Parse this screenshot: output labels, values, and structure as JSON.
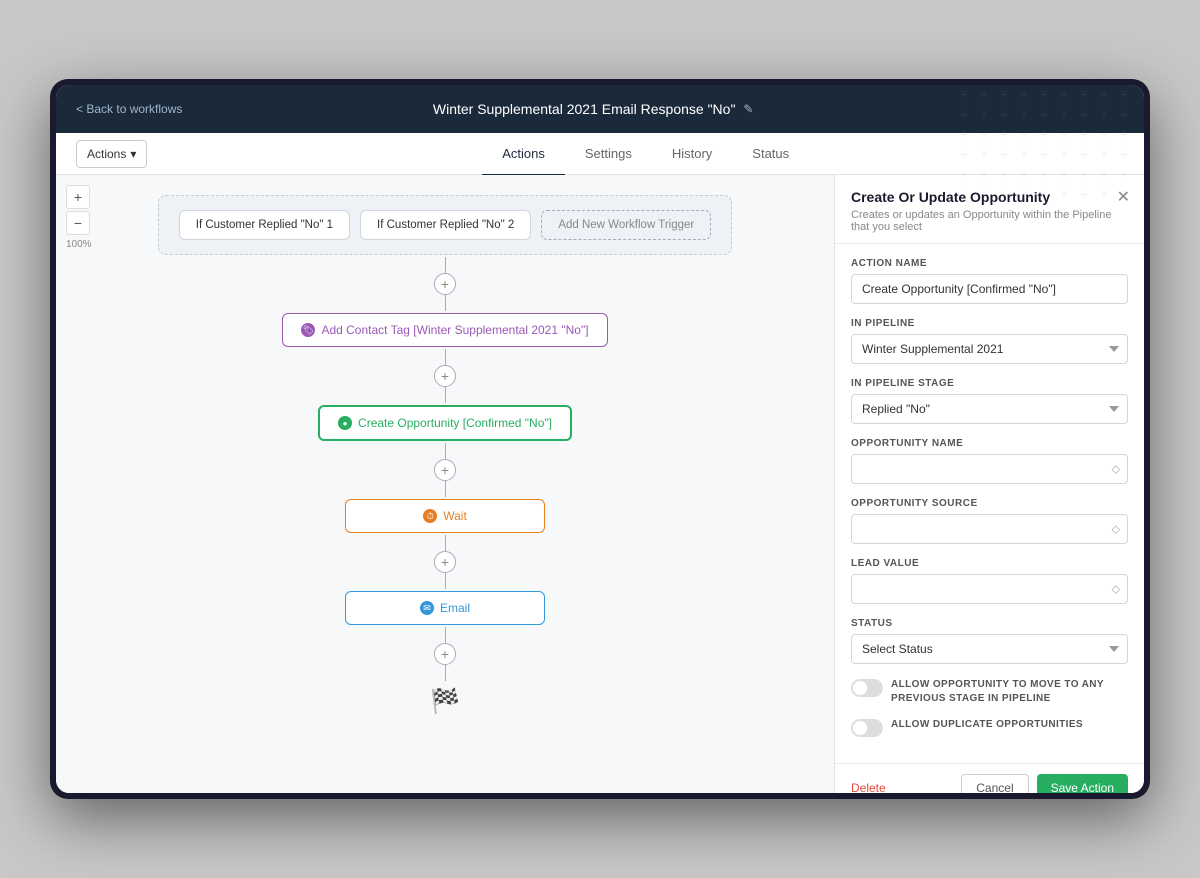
{
  "header": {
    "back_label": "< Back to workflows",
    "title": "Winter Supplemental 2021 Email Response \"No\"",
    "edit_icon": "✎"
  },
  "tabs_bar": {
    "actions_btn": "Actions",
    "tabs": [
      {
        "id": "actions",
        "label": "Actions",
        "active": true
      },
      {
        "id": "settings",
        "label": "Settings",
        "active": false
      },
      {
        "id": "history",
        "label": "History",
        "active": false
      },
      {
        "id": "status",
        "label": "Status",
        "active": false
      }
    ]
  },
  "canvas": {
    "zoom_plus": "+",
    "zoom_minus": "−",
    "zoom_level": "100%",
    "triggers": [
      {
        "label": "If Customer Replied \"No\" 1"
      },
      {
        "label": "If Customer Replied \"No\" 2"
      }
    ],
    "add_trigger_label": "Add New Workflow Trigger",
    "actions": [
      {
        "id": "tag",
        "type": "tag",
        "icon_color": "purple",
        "icon_char": "🏷",
        "label": "Add Contact Tag [Winter Supplemental 2021 \"No\"]"
      },
      {
        "id": "opportunity",
        "type": "opportunity",
        "icon_color": "green",
        "icon_char": "●",
        "label": "Create Opportunity [Confirmed \"No\"]"
      },
      {
        "id": "wait",
        "type": "wait",
        "icon_color": "orange",
        "icon_char": "⏱",
        "label": "Wait"
      },
      {
        "id": "email",
        "type": "email",
        "icon_color": "blue",
        "icon_char": "✉",
        "label": "Email"
      }
    ],
    "finish_flag": "🏁"
  },
  "panel": {
    "title": "Create Or Update Opportunity",
    "subtitle": "Creates or updates an Opportunity within the Pipeline that you select",
    "close_icon": "✕",
    "fields": {
      "action_name_label": "ACTION NAME",
      "action_name_value": "Create Opportunity [Confirmed \"No\"]",
      "in_pipeline_label": "IN PIPELINE",
      "in_pipeline_value": "Winter Supplemental 2021",
      "in_pipeline_stage_label": "IN PIPELINE STAGE",
      "in_pipeline_stage_value": "Replied \"No\"",
      "opportunity_name_label": "OPPORTUNITY NAME",
      "opportunity_name_placeholder": "",
      "opportunity_source_label": "OPPORTUNITY SOURCE",
      "opportunity_source_placeholder": "",
      "lead_value_label": "LEAD VALUE",
      "lead_value_placeholder": "",
      "status_label": "STATUS",
      "status_placeholder": "Select Status"
    },
    "toggles": [
      {
        "id": "allow_previous",
        "label": "ALLOW OPPORTUNITY TO MOVE TO ANY PREVIOUS STAGE IN PIPELINE"
      },
      {
        "id": "allow_duplicate",
        "label": "ALLOW DUPLICATE OPPORTUNITIES"
      }
    ],
    "footer": {
      "delete_label": "Delete",
      "cancel_label": "Cancel",
      "save_label": "Save Action"
    }
  }
}
